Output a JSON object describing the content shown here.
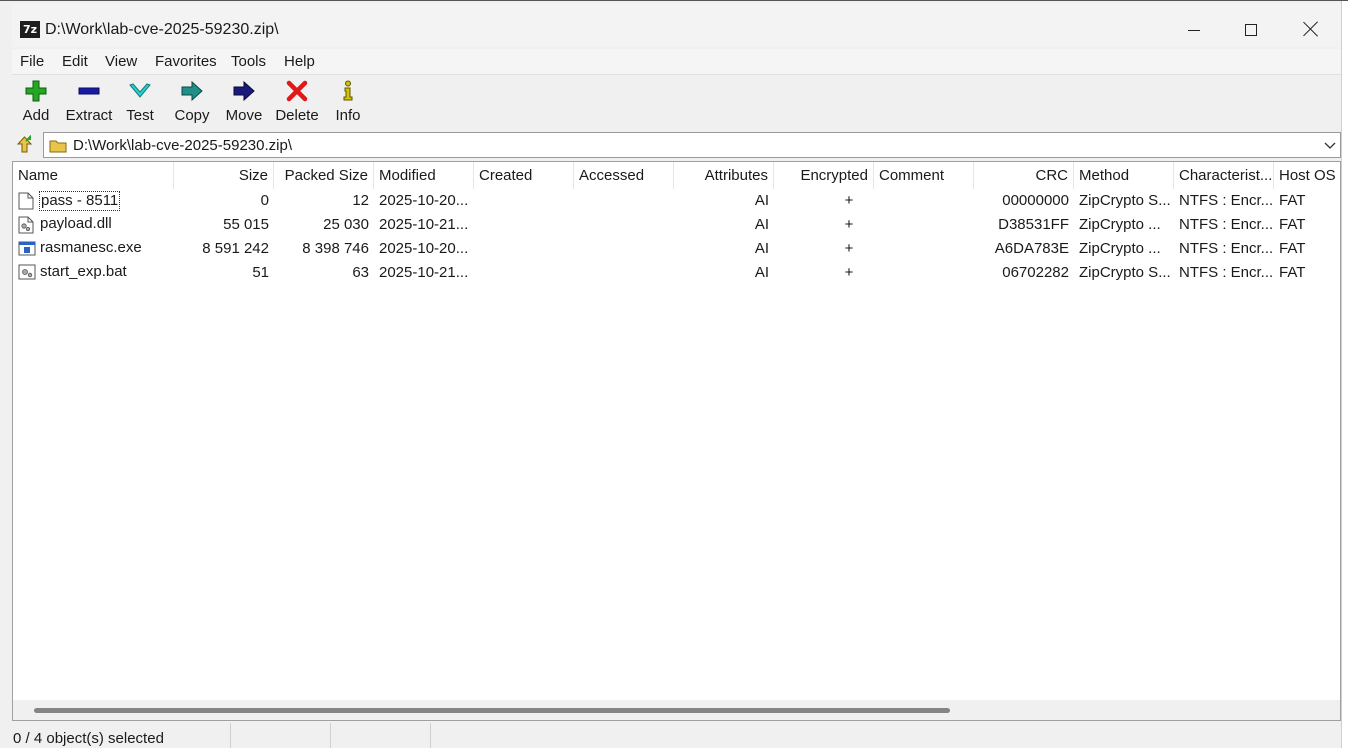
{
  "window": {
    "title": "D:\\Work\\lab-cve-2025-59230.zip\\",
    "app_icon_text": "7z"
  },
  "menu": [
    "File",
    "Edit",
    "View",
    "Favorites",
    "Tools",
    "Help"
  ],
  "toolbar": [
    {
      "label": "Add",
      "icon": "plus-icon",
      "color": "#22a822"
    },
    {
      "label": "Extract",
      "icon": "minus-icon",
      "color": "#1a1aa8"
    },
    {
      "label": "Test",
      "icon": "check-icon",
      "color": "#2ad0d0"
    },
    {
      "label": "Copy",
      "icon": "copy-arrow-icon",
      "color": "#1f8f87"
    },
    {
      "label": "Move",
      "icon": "move-arrow-icon",
      "color": "#1a1a7a"
    },
    {
      "label": "Delete",
      "icon": "delete-x-icon",
      "color": "#e01818"
    },
    {
      "label": "Info",
      "icon": "info-icon",
      "color": "#d6c400"
    }
  ],
  "address": {
    "path": "D:\\Work\\lab-cve-2025-59230.zip\\"
  },
  "columns": [
    "Name",
    "Size",
    "Packed Size",
    "Modified",
    "Created",
    "Accessed",
    "Attributes",
    "Encrypted",
    "Comment",
    "CRC",
    "Method",
    "Characterist...",
    "Host OS"
  ],
  "files": [
    {
      "name": "pass - 8511",
      "icon": "text-file-icon",
      "size": "0",
      "packed": "12",
      "modified": "2025-10-20...",
      "created": "",
      "accessed": "",
      "attributes": "AI",
      "encrypted": "+",
      "comment": "",
      "crc": "00000000",
      "method": "ZipCrypto S...",
      "characteristics": "NTFS : Encr...",
      "host_os": "FAT"
    },
    {
      "name": "payload.dll",
      "icon": "dll-file-icon",
      "size": "55 015",
      "packed": "25 030",
      "modified": "2025-10-21...",
      "created": "",
      "accessed": "",
      "attributes": "AI",
      "encrypted": "+",
      "comment": "",
      "crc": "D38531FF",
      "method": "ZipCrypto ...",
      "characteristics": "NTFS : Encr...",
      "host_os": "FAT"
    },
    {
      "name": "rasmanesc.exe",
      "icon": "exe-file-icon",
      "size": "8 591 242",
      "packed": "8 398 746",
      "modified": "2025-10-20...",
      "created": "",
      "accessed": "",
      "attributes": "AI",
      "encrypted": "+",
      "comment": "",
      "crc": "A6DA783E",
      "method": "ZipCrypto ...",
      "characteristics": "NTFS : Encr...",
      "host_os": "FAT"
    },
    {
      "name": "start_exp.bat",
      "icon": "bat-file-icon",
      "size": "51",
      "packed": "63",
      "modified": "2025-10-21...",
      "created": "",
      "accessed": "",
      "attributes": "AI",
      "encrypted": "+",
      "comment": "",
      "crc": "06702282",
      "method": "ZipCrypto S...",
      "characteristics": "NTFS : Encr...",
      "host_os": "FAT"
    }
  ],
  "status": {
    "text": "0 / 4 object(s) selected"
  }
}
